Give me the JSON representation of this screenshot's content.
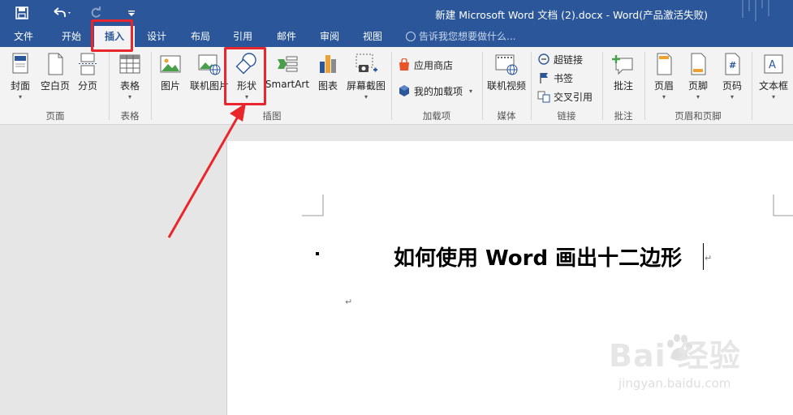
{
  "window": {
    "title": "新建 Microsoft Word 文档 (2).docx - Word(产品激活失败)"
  },
  "quick_access": {
    "save_icon": "save-icon",
    "undo_icon": "undo-icon",
    "redo_icon": "redo-icon",
    "customize_icon": "customize-icon"
  },
  "tabs": [
    {
      "label": "文件"
    },
    {
      "label": "开始"
    },
    {
      "label": "插入"
    },
    {
      "label": "设计"
    },
    {
      "label": "布局"
    },
    {
      "label": "引用"
    },
    {
      "label": "邮件"
    },
    {
      "label": "审阅"
    },
    {
      "label": "视图"
    }
  ],
  "tell_me": "告诉我您想要做什么...",
  "ribbon": {
    "pages": {
      "cover": "封面",
      "blank": "空白页",
      "break": "分页",
      "group": "页面"
    },
    "tables": {
      "table": "表格",
      "group": "表格"
    },
    "illustrations": {
      "picture": "图片",
      "online_picture": "联机图片",
      "shapes": "形状",
      "smartart": "SmartArt",
      "chart": "图表",
      "screenshot": "屏幕截图",
      "group": "插图"
    },
    "addins": {
      "store": "应用商店",
      "my_addins": "我的加载项",
      "group": "加载项"
    },
    "media": {
      "online_video": "联机视频",
      "group": "媒体"
    },
    "links": {
      "hyperlink": "超链接",
      "bookmark": "书签",
      "cross_ref": "交叉引用",
      "group": "链接"
    },
    "comments": {
      "comment": "批注",
      "group": "批注"
    },
    "header_footer": {
      "header": "页眉",
      "footer": "页脚",
      "page_number": "页码",
      "group": "页眉和页脚"
    },
    "text": {
      "textbox": "文本框"
    }
  },
  "document": {
    "heading": "如何使用 Word 画出十二边形",
    "para_mark": "↵"
  },
  "watermark": {
    "brand": "Bai  经验",
    "url": "jingyan.baidu.com"
  },
  "colors": {
    "title_bar": "#2b579a",
    "highlight": "#e8262b"
  }
}
